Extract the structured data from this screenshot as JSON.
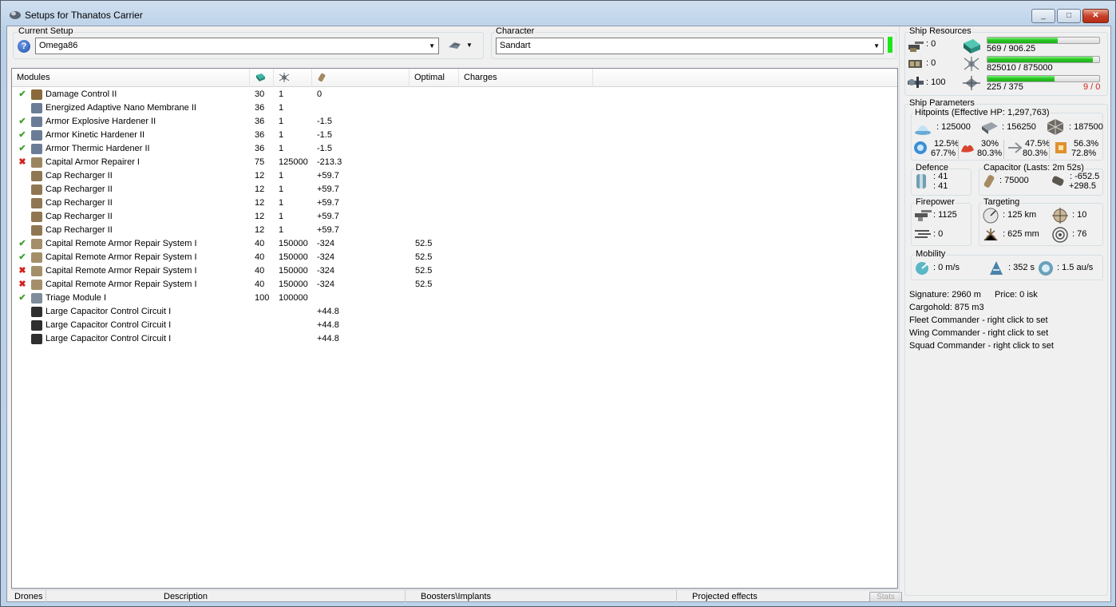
{
  "window": {
    "title": "Setups for Thanatos Carrier",
    "controls": {
      "minimize": "_",
      "maximize": "□",
      "close": "✕"
    }
  },
  "setup": {
    "label": "Current Setup",
    "selected": "Omega86"
  },
  "character": {
    "label": "Character",
    "selected": "Sandart",
    "status_color": "#1ee61a"
  },
  "modules_table": {
    "headers": [
      "Modules",
      "",
      "",
      "",
      "Optimal",
      "Charges"
    ],
    "rows": [
      {
        "status": "ok",
        "icon": "damage-control-icon",
        "name": "Damage Control II",
        "cpu": "30",
        "pg": "1",
        "cap": "0",
        "optimal": ""
      },
      {
        "status": "",
        "icon": "armor-hardener-icon",
        "name": "Energized Adaptive Nano Membrane II",
        "cpu": "36",
        "pg": "1",
        "cap": "",
        "optimal": ""
      },
      {
        "status": "ok",
        "icon": "armor-hardener-icon",
        "name": "Armor Explosive Hardener II",
        "cpu": "36",
        "pg": "1",
        "cap": "-1.5",
        "optimal": ""
      },
      {
        "status": "ok",
        "icon": "armor-hardener-icon",
        "name": "Armor Kinetic Hardener II",
        "cpu": "36",
        "pg": "1",
        "cap": "-1.5",
        "optimal": ""
      },
      {
        "status": "ok",
        "icon": "armor-hardener-icon",
        "name": "Armor Thermic Hardener II",
        "cpu": "36",
        "pg": "1",
        "cap": "-1.5",
        "optimal": ""
      },
      {
        "status": "bad",
        "icon": "armor-repairer-icon",
        "name": "Capital Armor Repairer I",
        "cpu": "75",
        "pg": "125000",
        "cap": "-213.3",
        "optimal": ""
      },
      {
        "status": "",
        "icon": "cap-recharger-icon",
        "name": "Cap Recharger II",
        "cpu": "12",
        "pg": "1",
        "cap": "+59.7",
        "optimal": ""
      },
      {
        "status": "",
        "icon": "cap-recharger-icon",
        "name": "Cap Recharger II",
        "cpu": "12",
        "pg": "1",
        "cap": "+59.7",
        "optimal": ""
      },
      {
        "status": "",
        "icon": "cap-recharger-icon",
        "name": "Cap Recharger II",
        "cpu": "12",
        "pg": "1",
        "cap": "+59.7",
        "optimal": ""
      },
      {
        "status": "",
        "icon": "cap-recharger-icon",
        "name": "Cap Recharger II",
        "cpu": "12",
        "pg": "1",
        "cap": "+59.7",
        "optimal": ""
      },
      {
        "status": "",
        "icon": "cap-recharger-icon",
        "name": "Cap Recharger II",
        "cpu": "12",
        "pg": "1",
        "cap": "+59.7",
        "optimal": ""
      },
      {
        "status": "ok",
        "icon": "remote-repair-icon",
        "name": "Capital Remote Armor Repair System I",
        "cpu": "40",
        "pg": "150000",
        "cap": "-324",
        "optimal": "52.5"
      },
      {
        "status": "ok",
        "icon": "remote-repair-icon",
        "name": "Capital Remote Armor Repair System I",
        "cpu": "40",
        "pg": "150000",
        "cap": "-324",
        "optimal": "52.5"
      },
      {
        "status": "bad",
        "icon": "remote-repair-icon",
        "name": "Capital Remote Armor Repair System I",
        "cpu": "40",
        "pg": "150000",
        "cap": "-324",
        "optimal": "52.5"
      },
      {
        "status": "bad",
        "icon": "remote-repair-icon",
        "name": "Capital Remote Armor Repair System I",
        "cpu": "40",
        "pg": "150000",
        "cap": "-324",
        "optimal": "52.5"
      },
      {
        "status": "ok",
        "icon": "triage-module-icon",
        "name": "Triage Module I",
        "cpu": "100",
        "pg": "100000",
        "cap": "",
        "optimal": ""
      },
      {
        "status": "",
        "icon": "rig-icon",
        "name": "Large Capacitor Control Circuit I",
        "cpu": "",
        "pg": "",
        "cap": "+44.8",
        "optimal": ""
      },
      {
        "status": "",
        "icon": "rig-icon",
        "name": "Large Capacitor Control Circuit I",
        "cpu": "",
        "pg": "",
        "cap": "+44.8",
        "optimal": ""
      },
      {
        "status": "",
        "icon": "rig-icon",
        "name": "Large Capacitor Control Circuit I",
        "cpu": "",
        "pg": "",
        "cap": "+44.8",
        "optimal": ""
      }
    ]
  },
  "bottom_tabs": {
    "drones": "Drones",
    "description": "Description",
    "boosters": "Boosters\\Implants",
    "projected": "Projected effects",
    "stats": "Stats"
  },
  "resources": {
    "label": "Ship Resources",
    "turrets": ": 0",
    "launchers": ": 0",
    "calibration": ": 100",
    "cpu_text": "569 / 906.25",
    "cpu_fraction": 0.628,
    "pg_text": "825010 / 875000",
    "pg_fraction": 0.943,
    "drone_text": "225 / 375",
    "drone_fraction": 0.6,
    "drone_count": "9 / 0"
  },
  "parameters": {
    "label": "Ship Parameters",
    "hitpoints_label": "Hitpoints (Effective HP: 1,297,763)",
    "shield_hp": ": 125000",
    "armor_hp": ": 156250",
    "hull_hp": ": 187500",
    "res_em": [
      "12.5%",
      "67.7%"
    ],
    "res_thermal": [
      "30%",
      "80.3%"
    ],
    "res_kinetic": [
      "47.5%",
      "80.3%"
    ],
    "res_explosive": [
      "56.3%",
      "72.8%"
    ],
    "defence_label": "Defence",
    "defence_1": ": 41",
    "defence_2": ": 41",
    "capacitor_label": "Capacitor (Lasts: 2m 52s)",
    "capacitor_value": ": 75000",
    "cap_delta_1": ": -652.5",
    "cap_delta_2": "+298.5",
    "firepower_label": "Firepower",
    "firepower_value": ": 1125",
    "firepower_2": ": 0",
    "targeting_label": "Targeting",
    "target_range": ": 125 km",
    "scan_res": ": 625 mm",
    "max_targets": ": 10",
    "sensor_strength": ": 76",
    "mobility_label": "Mobility",
    "speed": ": 0 m/s",
    "align": ": 352 s",
    "warp": ": 1.5 au/s",
    "signature": "Signature: 2960 m",
    "price": "Price: 0 isk",
    "cargohold": "Cargohold: 875 m3",
    "fleet_commander": "Fleet Commander - right click to set",
    "wing_commander": "Wing Commander - right click to set",
    "squad_commander": "Squad Commander - right click to set"
  },
  "colors": {
    "ok": "#3fa02c",
    "bad": "#d0221c",
    "bar_fill": "#27c521"
  }
}
